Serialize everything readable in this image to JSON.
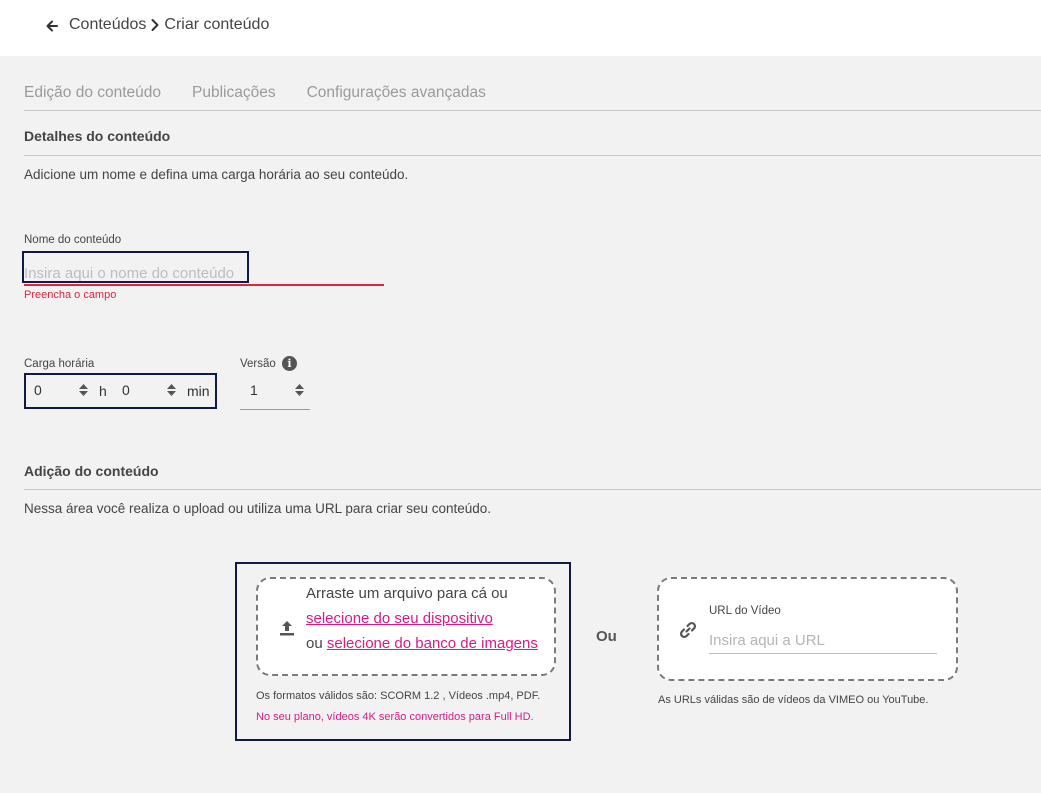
{
  "header": {
    "breadcrumb_root": "Conteúdos",
    "breadcrumb_current": "Criar conteúdo"
  },
  "tabs": [
    {
      "label": "Edição do conteúdo"
    },
    {
      "label": "Publicações"
    },
    {
      "label": "Configurações avançadas"
    }
  ],
  "details": {
    "title": "Detalhes do conteúdo",
    "description": "Adicione um nome e defina uma carga horária ao seu conteúdo.",
    "name_label": "Nome do conteúdo",
    "name_placeholder": "Insira aqui o nome do conteúdo",
    "name_value": "",
    "name_error": "Preencha o campo",
    "carga_label": "Carga horária",
    "hours_value": "0",
    "hours_unit": "h",
    "minutes_value": "0",
    "minutes_unit": "min",
    "versao_label": "Versão",
    "versao_value": "1"
  },
  "addition": {
    "title": "Adição do conteúdo",
    "description": "Nessa área você realiza o upload ou utiliza uma URL para criar seu conteúdo.",
    "drag_text": "Arraste um arquivo para cá ou",
    "select_device_link": "selecione do seu dispositivo",
    "or_text": "ou",
    "select_bank_link": "selecione do banco de imagens",
    "formats_text": "Os formatos válidos são: SCORM 1.2 , Vídeos .mp4, PDF.",
    "plan_note": "No seu plano, vídeos 4K serão convertidos para Full HD.",
    "ou_separator": "Ou",
    "url_label": "URL do Vídeo",
    "url_placeholder": "Insira aqui a URL",
    "url_value": "",
    "url_note": "As URLs válidas são de vídeos da VIMEO ou YouTube."
  },
  "colors": {
    "accent_link": "#d81b88",
    "error": "#d9283f",
    "focus_outline": "#0f1a45"
  },
  "icons": [
    "arrow-left-icon",
    "chevron-right-icon",
    "info-icon",
    "spinner-arrows-icon",
    "upload-icon",
    "link-icon"
  ]
}
